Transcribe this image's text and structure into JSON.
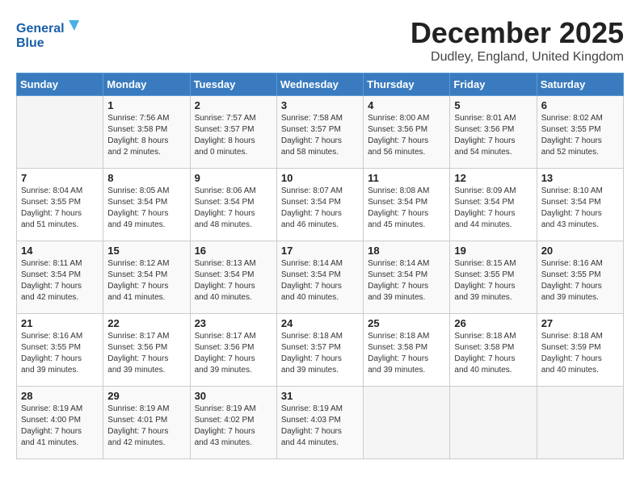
{
  "logo": {
    "line1": "General",
    "line2": "Blue"
  },
  "title": "December 2025",
  "location": "Dudley, England, United Kingdom",
  "days_of_week": [
    "Sunday",
    "Monday",
    "Tuesday",
    "Wednesday",
    "Thursday",
    "Friday",
    "Saturday"
  ],
  "weeks": [
    [
      {
        "day": "",
        "info": ""
      },
      {
        "day": "1",
        "info": "Sunrise: 7:56 AM\nSunset: 3:58 PM\nDaylight: 8 hours\nand 2 minutes."
      },
      {
        "day": "2",
        "info": "Sunrise: 7:57 AM\nSunset: 3:57 PM\nDaylight: 8 hours\nand 0 minutes."
      },
      {
        "day": "3",
        "info": "Sunrise: 7:58 AM\nSunset: 3:57 PM\nDaylight: 7 hours\nand 58 minutes."
      },
      {
        "day": "4",
        "info": "Sunrise: 8:00 AM\nSunset: 3:56 PM\nDaylight: 7 hours\nand 56 minutes."
      },
      {
        "day": "5",
        "info": "Sunrise: 8:01 AM\nSunset: 3:56 PM\nDaylight: 7 hours\nand 54 minutes."
      },
      {
        "day": "6",
        "info": "Sunrise: 8:02 AM\nSunset: 3:55 PM\nDaylight: 7 hours\nand 52 minutes."
      }
    ],
    [
      {
        "day": "7",
        "info": "Sunrise: 8:04 AM\nSunset: 3:55 PM\nDaylight: 7 hours\nand 51 minutes."
      },
      {
        "day": "8",
        "info": "Sunrise: 8:05 AM\nSunset: 3:54 PM\nDaylight: 7 hours\nand 49 minutes."
      },
      {
        "day": "9",
        "info": "Sunrise: 8:06 AM\nSunset: 3:54 PM\nDaylight: 7 hours\nand 48 minutes."
      },
      {
        "day": "10",
        "info": "Sunrise: 8:07 AM\nSunset: 3:54 PM\nDaylight: 7 hours\nand 46 minutes."
      },
      {
        "day": "11",
        "info": "Sunrise: 8:08 AM\nSunset: 3:54 PM\nDaylight: 7 hours\nand 45 minutes."
      },
      {
        "day": "12",
        "info": "Sunrise: 8:09 AM\nSunset: 3:54 PM\nDaylight: 7 hours\nand 44 minutes."
      },
      {
        "day": "13",
        "info": "Sunrise: 8:10 AM\nSunset: 3:54 PM\nDaylight: 7 hours\nand 43 minutes."
      }
    ],
    [
      {
        "day": "14",
        "info": "Sunrise: 8:11 AM\nSunset: 3:54 PM\nDaylight: 7 hours\nand 42 minutes."
      },
      {
        "day": "15",
        "info": "Sunrise: 8:12 AM\nSunset: 3:54 PM\nDaylight: 7 hours\nand 41 minutes."
      },
      {
        "day": "16",
        "info": "Sunrise: 8:13 AM\nSunset: 3:54 PM\nDaylight: 7 hours\nand 40 minutes."
      },
      {
        "day": "17",
        "info": "Sunrise: 8:14 AM\nSunset: 3:54 PM\nDaylight: 7 hours\nand 40 minutes."
      },
      {
        "day": "18",
        "info": "Sunrise: 8:14 AM\nSunset: 3:54 PM\nDaylight: 7 hours\nand 39 minutes."
      },
      {
        "day": "19",
        "info": "Sunrise: 8:15 AM\nSunset: 3:55 PM\nDaylight: 7 hours\nand 39 minutes."
      },
      {
        "day": "20",
        "info": "Sunrise: 8:16 AM\nSunset: 3:55 PM\nDaylight: 7 hours\nand 39 minutes."
      }
    ],
    [
      {
        "day": "21",
        "info": "Sunrise: 8:16 AM\nSunset: 3:55 PM\nDaylight: 7 hours\nand 39 minutes."
      },
      {
        "day": "22",
        "info": "Sunrise: 8:17 AM\nSunset: 3:56 PM\nDaylight: 7 hours\nand 39 minutes."
      },
      {
        "day": "23",
        "info": "Sunrise: 8:17 AM\nSunset: 3:56 PM\nDaylight: 7 hours\nand 39 minutes."
      },
      {
        "day": "24",
        "info": "Sunrise: 8:18 AM\nSunset: 3:57 PM\nDaylight: 7 hours\nand 39 minutes."
      },
      {
        "day": "25",
        "info": "Sunrise: 8:18 AM\nSunset: 3:58 PM\nDaylight: 7 hours\nand 39 minutes."
      },
      {
        "day": "26",
        "info": "Sunrise: 8:18 AM\nSunset: 3:58 PM\nDaylight: 7 hours\nand 40 minutes."
      },
      {
        "day": "27",
        "info": "Sunrise: 8:18 AM\nSunset: 3:59 PM\nDaylight: 7 hours\nand 40 minutes."
      }
    ],
    [
      {
        "day": "28",
        "info": "Sunrise: 8:19 AM\nSunset: 4:00 PM\nDaylight: 7 hours\nand 41 minutes."
      },
      {
        "day": "29",
        "info": "Sunrise: 8:19 AM\nSunset: 4:01 PM\nDaylight: 7 hours\nand 42 minutes."
      },
      {
        "day": "30",
        "info": "Sunrise: 8:19 AM\nSunset: 4:02 PM\nDaylight: 7 hours\nand 43 minutes."
      },
      {
        "day": "31",
        "info": "Sunrise: 8:19 AM\nSunset: 4:03 PM\nDaylight: 7 hours\nand 44 minutes."
      },
      {
        "day": "",
        "info": ""
      },
      {
        "day": "",
        "info": ""
      },
      {
        "day": "",
        "info": ""
      }
    ]
  ]
}
